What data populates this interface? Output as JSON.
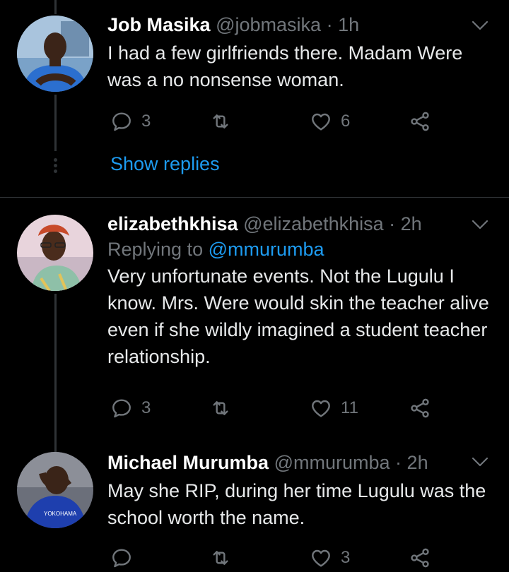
{
  "tweets": [
    {
      "name": "Job Masika",
      "handle": "@jobmasika",
      "sep": "·",
      "time": "1h",
      "replying_prefix": "",
      "replying_to": "",
      "text": "I had a few girlfriends there. Madam Were was a no nonsense woman.",
      "replies": "3",
      "retweets": "",
      "likes": "6",
      "show_replies": "Show replies"
    },
    {
      "name": "elizabethkhisa",
      "handle": "@elizabethkhisa",
      "sep": "·",
      "time": "2h",
      "replying_prefix": "Replying to",
      "replying_to": "@mmurumba",
      "text": "Very unfortunate events. Not the Lugulu I know. Mrs. Were would skin the teacher alive even if she wildly imagined a student teacher relationship.",
      "replies": "3",
      "retweets": "",
      "likes": "11"
    },
    {
      "name": "Michael Murumba",
      "handle": "@mmurumba",
      "sep": "·",
      "time": "2h",
      "text": "May she RIP, during her time Lugulu was the school worth the name.",
      "replies": "",
      "retweets": "",
      "likes": "3"
    }
  ],
  "icons": {
    "reply": "reply-icon",
    "retweet": "retweet-icon",
    "like": "heart-icon",
    "share": "share-icon",
    "caret": "chevron-down-icon"
  },
  "colors": {
    "background": "#000000",
    "text": "#e7e9ea",
    "muted": "#71767b",
    "link": "#1d9bf0",
    "line": "#2f3336"
  }
}
